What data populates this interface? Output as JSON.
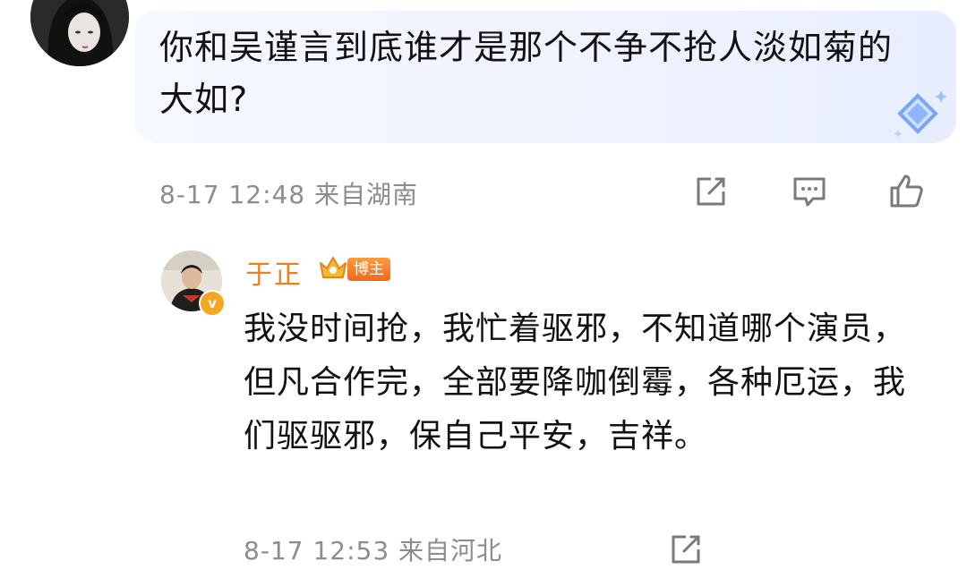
{
  "comment": {
    "text": "你和吴谨言到底谁才是那个不争不抢人淡如菊的大如?",
    "timestamp": "8-17 12:48",
    "location": "来自湖南"
  },
  "reply": {
    "username": "于正",
    "badge_label": "博主",
    "verified_mark": "v",
    "text": "我没时间抢，我忙着驱邪，不知道哪个演员，但凡合作完，全部要降咖倒霉，各种厄运，我们驱驱邪，保自己平安，吉祥。",
    "timestamp": "8-17 12:53",
    "location": "来自河北"
  },
  "colors": {
    "username": "#e8821e",
    "meta": "#8c8c8c",
    "bubble": "#eef2ff",
    "badge": "#f26a1b"
  }
}
